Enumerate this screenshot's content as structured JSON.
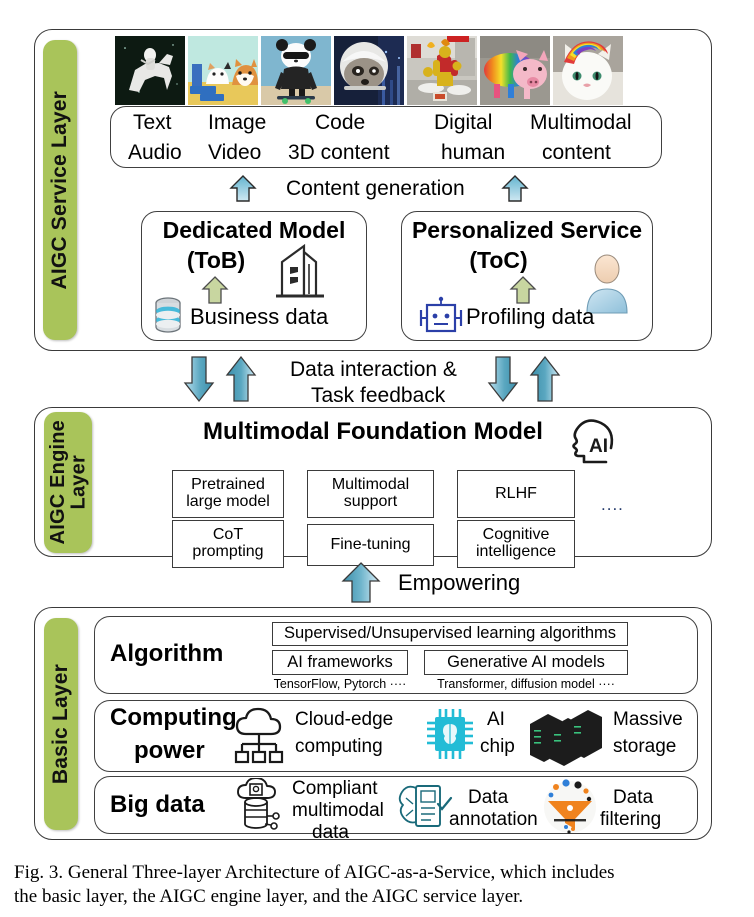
{
  "figure": {
    "caption_line1": "Fig. 3.  General Three-layer Architecture of AIGC-as-a-Service, which includes",
    "caption_line2": "the basic layer, the AIGC engine layer, and the AIGC service layer."
  },
  "colors": {
    "sidebar_green": "#a9c45a",
    "arrow_blue": "#3f93ab",
    "arrow_green": "#c3d29a",
    "border_dark": "#3a3a3a"
  },
  "service_layer": {
    "side_label": "AIGC Service Layer",
    "thumbnails": [
      {
        "name": "astronaut-riding-horse",
        "alt": "astronaut riding a white horse in space"
      },
      {
        "name": "cat-and-corgi-painting",
        "alt": "cat and corgi dog at a desk, painted style"
      },
      {
        "name": "panda-skateboarding",
        "alt": "panda in leather jacket skateboarding"
      },
      {
        "name": "raccoon-in-helmet",
        "alt": "raccoon wearing a space helmet"
      },
      {
        "name": "ironman-cooking",
        "alt": "iron man style figure cooking in a kitchen"
      },
      {
        "name": "rainbow-pig",
        "alt": "rainbow striped pig"
      },
      {
        "name": "rainbow-hair-cat",
        "alt": "white cat with rainbow colored hair"
      }
    ],
    "modalities": {
      "row1": [
        "Text",
        "Image",
        "Code",
        "Digital",
        "Multimodal"
      ],
      "row2": [
        "Audio",
        "Video",
        "3D content",
        "human",
        "content"
      ]
    },
    "content_generation_label": "Content generation",
    "tob": {
      "title_line1": "Dedicated Model",
      "title_line2": "(ToB)",
      "data_label": "Business data",
      "icons": [
        "database-icon",
        "office-building-icon",
        "up-arrow-green-icon"
      ]
    },
    "toc": {
      "title_line1": "Personalized Service",
      "title_line2": "(ToC)",
      "data_label": "Profiling data",
      "icons": [
        "robot-icon",
        "user-avatar-icon",
        "up-arrow-green-icon"
      ]
    }
  },
  "interconnect": {
    "label_line1": "Data interaction &",
    "label_line2": "Task feedback",
    "arrows": [
      "down-arrow-blue-icon",
      "up-arrow-blue-icon",
      "down-arrow-blue-icon",
      "up-arrow-blue-icon"
    ]
  },
  "engine_layer": {
    "side_label_line1": "AIGC Engine",
    "side_label_line2": "Layer",
    "title": "Multimodal Foundation Model",
    "ai_head_icon": "ai-head-icon",
    "ai_head_text": "AI",
    "capabilities_row1": [
      "Pretrained\nlarge model",
      "Multimodal\nsupport",
      "RLHF"
    ],
    "capabilities_row2": [
      "CoT\nprompting",
      "Fine-tuning",
      "Cognitive\nintelligence"
    ],
    "ellipsis": "....",
    "empowering_label": "Empowering"
  },
  "basic_layer": {
    "side_label": "Basic Layer",
    "algorithm": {
      "title": "Algorithm",
      "wide_box": "Supervised/Unsupervised learning algorithms",
      "box_left": "AI frameworks",
      "box_right": "Generative AI models",
      "sub_left": "TensorFlow, Pytorch ····",
      "sub_right": "Transformer,  diffusion model ····"
    },
    "computing": {
      "title_line1": "Computing",
      "title_line2": "power",
      "items": [
        {
          "icon": "cloud-edge-icon",
          "label_line1": "Cloud-edge",
          "label_line2": "computing"
        },
        {
          "icon": "ai-chip-icon",
          "label_line1": "AI",
          "label_line2": "chip"
        },
        {
          "icon": "server-rack-icon",
          "label_line1": "Massive",
          "label_line2": "storage"
        }
      ]
    },
    "bigdata": {
      "title": "Big data",
      "items": [
        {
          "icon": "cloud-database-icon",
          "label_line1": "Compliant",
          "label_line2": "multimodal",
          "label_line3": "data"
        },
        {
          "icon": "annotation-icon",
          "label_line1": "Data",
          "label_line2": "annotation",
          "label_line3": ""
        },
        {
          "icon": "funnel-filter-icon",
          "label_line1": "Data",
          "label_line2": "filtering",
          "label_line3": ""
        }
      ]
    }
  }
}
